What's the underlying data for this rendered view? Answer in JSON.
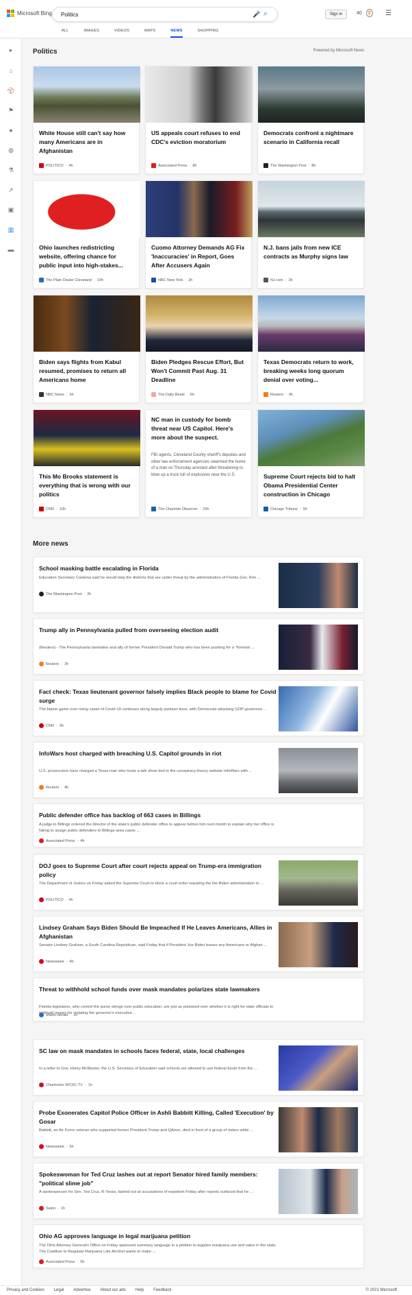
{
  "header": {
    "brand": "Microsoft Bing",
    "brand_colors": [
      "#f25022",
      "#7fba00",
      "#00a4ef",
      "#ffb900"
    ],
    "query": "Politics",
    "signin": "Sign in",
    "rewards": "40",
    "tabs": [
      "ALL",
      "IMAGES",
      "VIDEOS",
      "MAPS",
      "NEWS",
      "SHOPPING"
    ],
    "active_tab": "NEWS",
    "accent": "#174ae4"
  },
  "sidebar": {
    "icons": [
      "chevron-right-icon",
      "home-icon",
      "sports-icon",
      "flag-icon",
      "location-icon",
      "globe-icon",
      "science-icon",
      "rocket-icon",
      "entertainment-icon",
      "bank-icon",
      "card-icon"
    ]
  },
  "section": {
    "title": "Politics",
    "powered": "Powered by Microsoft News"
  },
  "cards": [
    {
      "title": "White House still can't say how many Americans are in Afghanistan",
      "source": "POLITICO",
      "time": "4h",
      "logo": "#d0021b",
      "img": "airport"
    },
    {
      "title": "US appeals court refuses to end CDC's eviction moratorium",
      "source": "Associated Press",
      "time": "8h",
      "logo": "#e21b1b",
      "img": "eviction"
    },
    {
      "title": "Democrats confront a nightmare scenario in California recall",
      "source": "The Washington Post",
      "time": "8h",
      "logo": "#222",
      "img": "recall"
    },
    {
      "title": "Ohio launches redistricting website, offering chance for public input into high-stakes...",
      "source": "The Plain Dealer Cleveland",
      "time": "10h",
      "logo": "#2c6db5",
      "img": "map"
    },
    {
      "title": "Cuomo Attorney Demands AG Fix 'Inaccuracies' in Report, Goes After Accusers Again",
      "source": "NBC New York",
      "time": "2h",
      "logo": "#1b4d9b",
      "img": "cuomo"
    },
    {
      "title": "N.J. bans jails from new ICE contracts as Murphy signs law",
      "source": "NJ.com",
      "time": "3h",
      "logo": "#555",
      "img": "jail"
    },
    {
      "title": "Biden says flights from Kabul resumed, promises to return all Americans home",
      "source": "NBC News",
      "time": "6h",
      "logo": "#333",
      "img": "biden1"
    },
    {
      "title": "Biden Pledges Rescue Effort, But Won't Commit Past Aug. 31 Deadline",
      "source": "The Daily Beast",
      "time": "6h",
      "logo": "#f3a6a6",
      "img": "biden2"
    },
    {
      "title": "Texas Democrats return to work, breaking weeks long quorum denial over voting...",
      "source": "Reuters",
      "time": "9h",
      "logo": "#f07c1e",
      "img": "capitol"
    },
    {
      "title": "This Mo Brooks statement is everything that is wrong with our politics",
      "source": "CNN",
      "time": "10h",
      "logo": "#cc0000",
      "img": "brooks"
    },
    {
      "title": "NC man in custody for bomb threat near US Capitol. Here's more about the suspect.",
      "snippet": "FBI agents, Cleveland County sheriff's deputies and other law enforcement agencies swarmed the home of a man on Thursday arrested after threatening to blow up a truck full of explosives near the U.S.",
      "source": "The Charlotte Observer",
      "time": "10h",
      "logo": "#1f5fa8",
      "img": "none"
    },
    {
      "title": "Supreme Court rejects bid to halt Obama Presidential Center construction in Chicago",
      "source": "Chicago Tribune",
      "time": "5h",
      "logo": "#1a5aa6",
      "img": "park"
    }
  ],
  "more": {
    "title": "More news",
    "items": [
      {
        "title": "School masking battle escalating in Florida",
        "snippet": "Education Secretary Cardona said he would help the districts that are under threat by the administration of Florida Gov. Ron ...",
        "source": "The Washington Post",
        "time": "2h",
        "logo": "#222",
        "img": "desantis"
      },
      {
        "title": "Trump ally in Pennsylvania pulled from overseeing election audit",
        "snippet": "(Reuters) - The Pennsylvania lawmaker and ally of former President Donald Trump who has been pushing for a \"forensic ...",
        "source": "Reuters",
        "time": "3h",
        "logo": "#f07c1e",
        "img": "speaker"
      },
      {
        "title": "Fact check: Texas lieutenant governor falsely implies Black people to blame for Covid surge",
        "snippet": "The blame game over rising cases of Covid-19 continues along largely partisan lines, with Democrats attacking GOP governors ...",
        "source": "CNN",
        "time": "3h",
        "logo": "#cc0000",
        "img": "vaccine"
      },
      {
        "title": "InfoWars host charged with breaching U.S. Capitol grounds in riot",
        "snippet": "U.S. prosecutors have charged a Texas man who hosts a talk show tied to the conspiracy-theory website InfoWars with ...",
        "source": "Reuters",
        "time": "4h",
        "logo": "#f07c1e",
        "img": "dome"
      },
      {
        "title": "Public defender office has backlog of 663 cases in Billings",
        "snippet": "A judge in Billings ordered the director of the state's public defender office to appear before him next month to explain why her office is failing to assign public defenders to Billings-area cases ...",
        "source": "Associated Press",
        "time": "4h",
        "logo": "#e21b1b",
        "img": "none"
      },
      {
        "title": "DOJ goes to Supreme Court after court rejects appeal on Trump-era immigration policy",
        "snippet": "The Department of Justice on Friday asked the Supreme Court to block a court order requiring the the Biden administration to ...",
        "source": "POLITICO",
        "time": "4h",
        "logo": "#d0021b",
        "img": "border"
      },
      {
        "title": "Lindsey Graham Says Biden Should Be Impeached If He Leaves Americans, Allies in Afghanistan",
        "snippet": "Senator Lindsey Graham, a South Carolina Republican, said Friday that if President Joe Biden leaves any Americans or Afghan ...",
        "source": "Newsweek",
        "time": "4h",
        "logo": "#e0001b",
        "img": "graham"
      },
      {
        "title": "Threat to withhold school funds over mask mandates polarizes state lawmakers",
        "snippet": "Florida legislators, who control the purse strings over public education, are just as polarized over whether it is right for state officials to withhold money for violating the governor's executive ...",
        "source": "Miami Herald",
        "time": "1h",
        "logo": "#2c6db5",
        "img": "none"
      },
      {
        "title": "SC law on mask mandates in schools faces federal, state, local challenges",
        "snippet": "In a letter to Gov. Henry McMaster, the U.S. Secretary of Education said schools are allowed to use federal funds from the ...",
        "source": "Charleston WCSC-TV",
        "time": "1h",
        "logo": "#c8102e",
        "img": "classroom"
      },
      {
        "title": "Probe Exonerates Capitol Police Officer in Ashli Babbitt Killing, Called 'Execution' by Gosar",
        "snippet": "Babbitt, an Air Force veteran who supported former President Trump and QAnon, died in front of a group of rioters while ...",
        "source": "Newsweek",
        "time": "5h",
        "logo": "#e0001b",
        "img": "gosar"
      },
      {
        "title": "Spokeswoman for Ted Cruz lashes out at report Senator hired family members: \"political slime job\"",
        "snippet": "A spokesperson for Sen. Ted Cruz, R-Texas, lashed out at accusations of nepotism Friday after reports surfaced that he ...",
        "source": "Salon",
        "time": "1h",
        "logo": "#cc2222",
        "img": "cruz"
      },
      {
        "title": "Ohio AG approves language in legal marijuana petition",
        "snippet": "The Ohio Attorney General's Office on Friday approved summary language in a petition to legalize marijuana use and sales in the state. The Coalition to Regulate Marijuana Like Alcohol wants to make ...",
        "source": "Associated Press",
        "time": "5h",
        "logo": "#e21b1b",
        "img": "none"
      }
    ]
  },
  "footer": {
    "links": [
      "Privacy and Cookies",
      "Legal",
      "Advertise",
      "About our ads",
      "Help",
      "Feedback"
    ],
    "copyright": "© 2021 Microsoft"
  }
}
